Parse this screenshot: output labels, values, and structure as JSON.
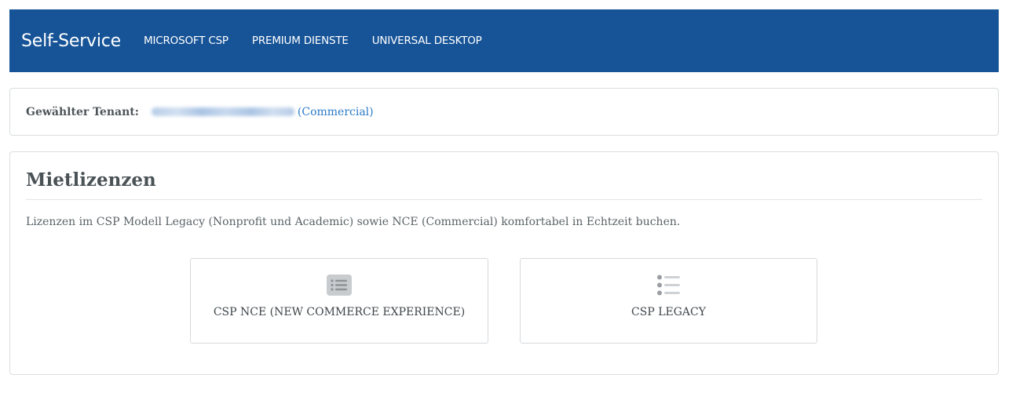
{
  "navbar": {
    "brand": "Self-Service",
    "items": [
      {
        "label": "MICROSOFT CSP"
      },
      {
        "label": "PREMIUM DIENSTE"
      },
      {
        "label": "UNIVERSAL DESKTOP"
      }
    ],
    "background": "#175497"
  },
  "tenant": {
    "label": "Gewählter Tenant:",
    "type": "(Commercial)"
  },
  "panel": {
    "title": "Mietlizenzen",
    "description": "Lizenzen im CSP Modell Legacy (Nonprofit und Academic) sowie NCE (Commercial) komfortabel in Echtzeit buchen.",
    "cards": [
      {
        "label": "CSP NCE (NEW COMMERCE EXPERIENCE)",
        "icon": "list-box-icon"
      },
      {
        "label": "CSP LEGACY",
        "icon": "list-icon"
      }
    ]
  },
  "colors": {
    "accent": "#175497",
    "link": "#2a7ac7"
  }
}
